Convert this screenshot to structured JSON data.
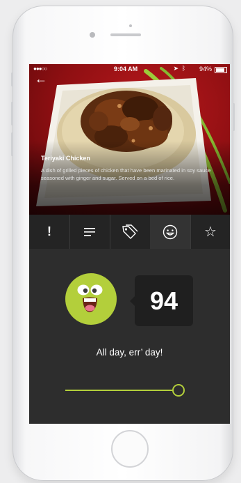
{
  "status_bar": {
    "signal": "●●●○○",
    "time": "9:04 AM",
    "battery": "94%"
  },
  "nav": {
    "back_glyph": "←"
  },
  "dish": {
    "title": "Teriyaki Chicken",
    "description": "A dish of grilled pieces of chicken that have been marinated in soy sauce seasoned with ginger and sugar. Served on a bed of rice."
  },
  "tabs": [
    {
      "icon": "exclamation-icon",
      "glyph": "!",
      "active": false
    },
    {
      "icon": "list-icon",
      "active": false
    },
    {
      "icon": "tags-icon",
      "active": false
    },
    {
      "icon": "smiley-icon",
      "active": true
    },
    {
      "icon": "star-icon",
      "glyph": "☆",
      "active": false
    }
  ],
  "rating": {
    "score": "94",
    "tagline": "All day, err’ day!",
    "slider_value_percent": 94
  },
  "colors": {
    "accent": "#b3cf3b",
    "background": "#2d2d2d",
    "hero_red": "#b8181c"
  }
}
